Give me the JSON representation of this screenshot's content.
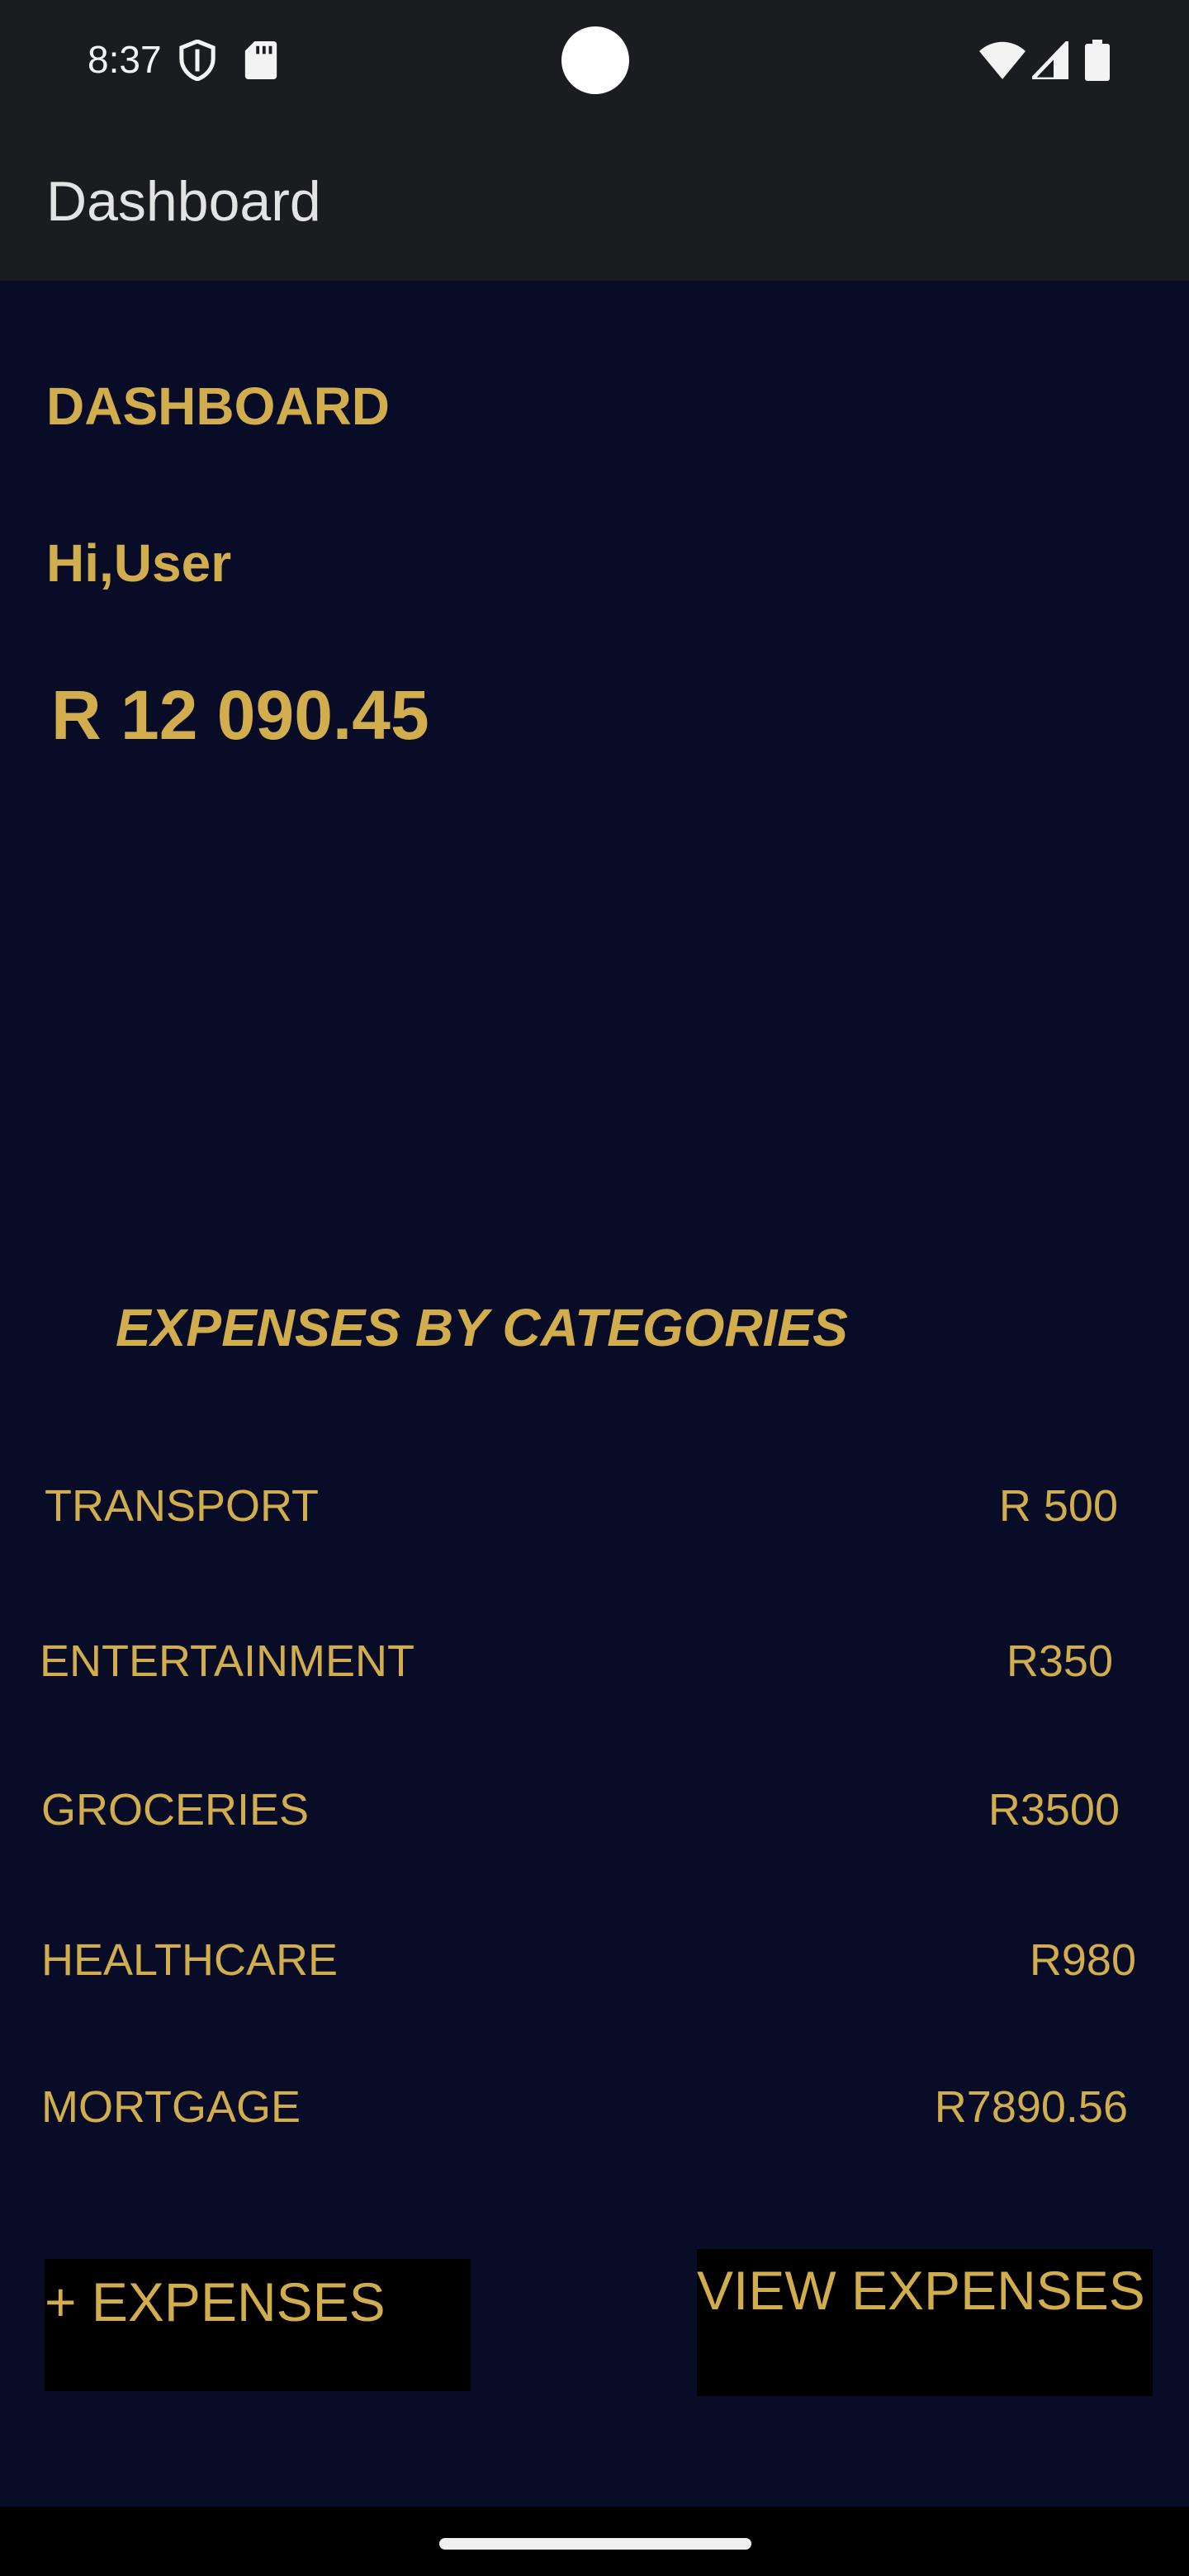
{
  "status_bar": {
    "time": "8:37",
    "icons": [
      "shield-icon",
      "sd-card-icon",
      "wifi-icon",
      "signal-icon",
      "battery-icon"
    ]
  },
  "app_bar": {
    "title": "Dashboard"
  },
  "main": {
    "heading": "DASHBOARD",
    "greeting": "Hi,User",
    "balance": "R 12 090.45"
  },
  "expenses": {
    "title": "EXPENSES BY CATEGORIES",
    "categories": [
      {
        "name": "TRANSPORT",
        "amount": "R 500"
      },
      {
        "name": "ENTERTAINMENT",
        "amount": "R350"
      },
      {
        "name": "GROCERIES",
        "amount": "R3500"
      },
      {
        "name": "HEALTHCARE",
        "amount": "R980"
      },
      {
        "name": "MORTGAGE",
        "amount": "R7890.56"
      }
    ]
  },
  "actions": {
    "add_expenses_label": "+ EXPENSES",
    "view_expenses_label": "VIEW EXPENSES"
  },
  "colors": {
    "background": "#080c27",
    "accent_gold": "#d2ad4d",
    "app_bar": "#1b1c20",
    "button_background": "#000000"
  }
}
